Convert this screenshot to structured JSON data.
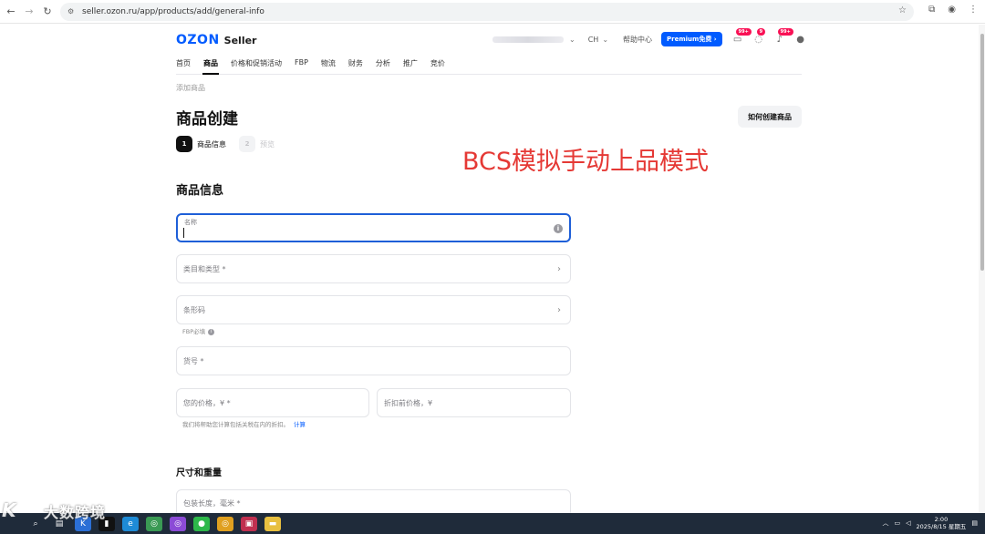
{
  "browser": {
    "url": "seller.ozon.ru/app/products/add/general-info"
  },
  "header": {
    "logo_brand": "OZON",
    "logo_sub": "Seller",
    "lang": "CH",
    "help": "帮助中心",
    "premium": "Premium免费 ›",
    "badges": [
      "99+",
      "9",
      "99+"
    ]
  },
  "nav": {
    "items": [
      "首页",
      "商品",
      "价格和促销活动",
      "FBP",
      "物流",
      "财务",
      "分析",
      "推广",
      "竞价"
    ],
    "active_index": 1
  },
  "breadcrumb": "添加商品",
  "page": {
    "title": "商品创建",
    "howto_button": "如何创建商品"
  },
  "steps": [
    {
      "num": "1",
      "label": "商品信息",
      "active": true
    },
    {
      "num": "2",
      "label": "预览",
      "active": false
    }
  ],
  "overlay": "BCS模拟手动上品模式",
  "section_product": "商品信息",
  "fields": {
    "name": "名称",
    "category": "类目和类型 *",
    "barcode": "条形码",
    "barcode_hint": "FBP必填",
    "sku": "货号 *",
    "price": "您的价格，¥ *",
    "old_price": "折扣前价格，¥",
    "price_hint": "我们将帮助您计算包括关税在内的折扣。",
    "price_hint_link": "计算"
  },
  "section_dimensions": "尺寸和重量",
  "dimension_field": "包装长度，毫米 *",
  "watermark": "大数跨境",
  "taskbar": {
    "time": "2:00",
    "date": "2025/8/15 星期五"
  },
  "colors": {
    "brand": "#005bff",
    "focus": "#1e5fd8",
    "overlay": "#e53935",
    "badge": "#f91155"
  }
}
